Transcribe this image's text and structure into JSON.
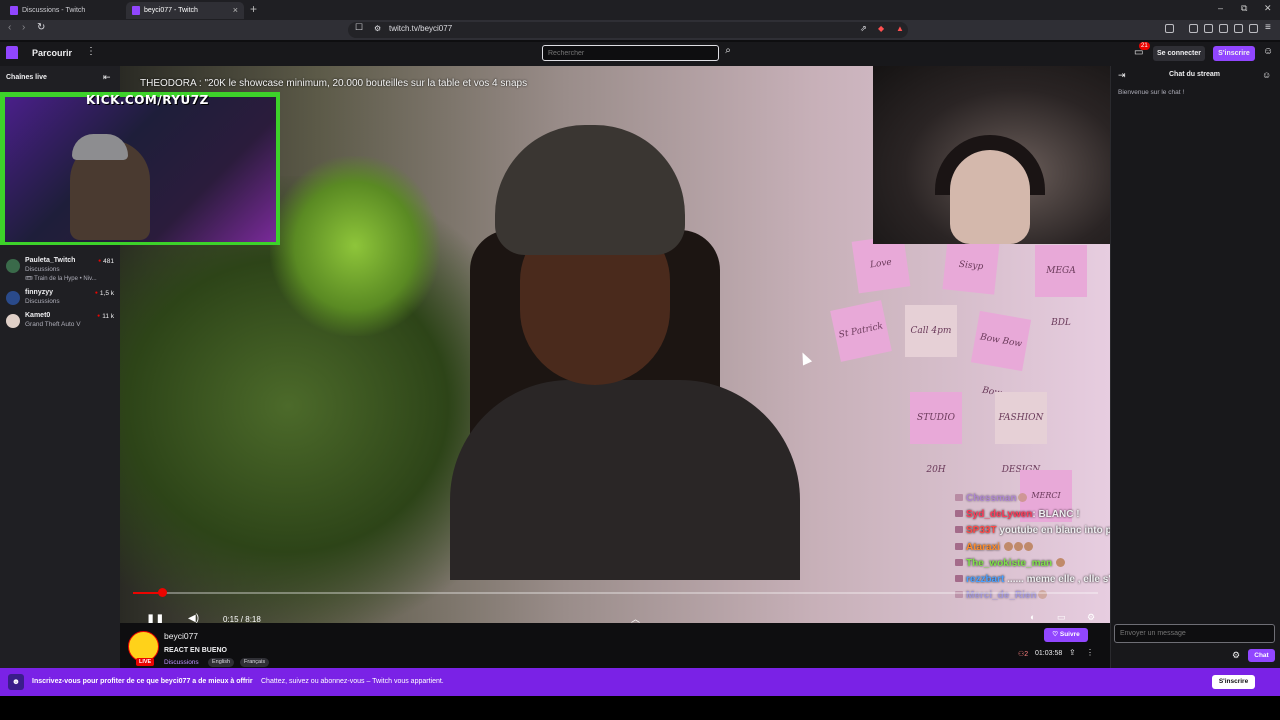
{
  "browser": {
    "tabs": [
      {
        "label": "Discussions - Twitch",
        "active": false
      },
      {
        "label": "beyci077 - Twitch",
        "active": true
      }
    ],
    "new_tab": "+",
    "url": "twitch.tv/beyci077",
    "window_controls": [
      "–",
      "⧉",
      "✕"
    ]
  },
  "topnav": {
    "browse": "Parcourir",
    "more": "⋮",
    "search_placeholder": "Rechercher",
    "notifications_count": "21",
    "login": "Se connecter",
    "signup": "S'inscrire"
  },
  "sidebar": {
    "header": "Chaînes live",
    "channels": [
      {
        "name": "Pauleta_Twitch",
        "category": "Discussions",
        "extra": "🎟 Train de la Hype • Niv...",
        "viewers": "481",
        "avatar_color": "#3a6a4a"
      },
      {
        "name": "finnyzyy",
        "category": "Discussions",
        "viewers": "1,5 k",
        "avatar_color": "#2a4a8a"
      },
      {
        "name": "Kamet0",
        "category": "Grand Theft Auto V",
        "viewers": "11 k",
        "avatar_color": "#e0d0c8"
      }
    ]
  },
  "video": {
    "caption": "THEODORA : \"20K le showcase minimum, 20.000 bouteilles sur la table et vos 4 snaps",
    "kick_overlay": "KICK.COM/RYU7Z",
    "notes": [
      "Love",
      "Sisyp",
      "MEGA BDL",
      "St Patrick",
      "Call 4pm",
      "Bow Bow Bow",
      "STUDIO 20H",
      "FASHION DESIGN",
      "MERCI"
    ],
    "overlay_chat": [
      {
        "user": "Chessman",
        "msg": "",
        "color": "#8f5fd0"
      },
      {
        "user": "Syd_deLywen",
        "msg": "BLANC !",
        "color": "#ff3c5a"
      },
      {
        "user": "SP33T",
        "msg": "youtube en blanc into pub",
        "color": "#ff4a4a"
      },
      {
        "user": "Ataraxi",
        "msg": "",
        "color": "#ff8c2a"
      },
      {
        "user": "The_wokiste_man",
        "msg": "",
        "color": "#7fe04a"
      },
      {
        "user": "rezzbart",
        "msg": "...... meme elle , elle s'autoflash",
        "color": "#4aa0ff"
      },
      {
        "user": "Merci_de_Rien",
        "msg": "",
        "color": "#6a6ae0"
      }
    ],
    "progress": 0.03,
    "time": "0:15 / 8:18"
  },
  "info": {
    "channel": "beyci077",
    "live": "LIVE",
    "title": "REACT EN BUENO",
    "category": "Discussions",
    "tags": [
      "English",
      "Français"
    ],
    "follow": "Suivre",
    "viewers": "2",
    "uptime": "01:03:58"
  },
  "chat": {
    "header": "Chat du stream",
    "welcome": "Bienvenue sur le chat !",
    "input_placeholder": "Envoyer un message",
    "send": "Chat"
  },
  "banner": {
    "bold": "Inscrivez-vous pour profiter de ce que beyci077 a de mieux à offrir",
    "text": "Chattez, suivez ou abonnez-vous – Twitch vous appartient.",
    "button": "S'inscrire"
  },
  "colors": {
    "brand": "#9146ff",
    "live": "#eb0400",
    "kick_border": "#3dd22a"
  }
}
